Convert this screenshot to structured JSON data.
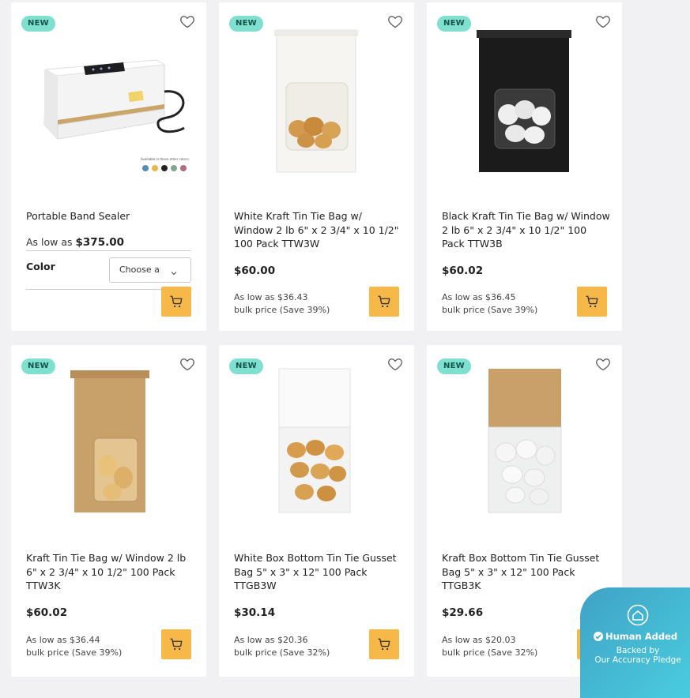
{
  "products": [
    {
      "badge": "NEW",
      "title": "Portable Band Sealer",
      "as_low_prefix": "As low as",
      "as_low_price": "$375.00",
      "color_label": "Color",
      "color_select": "Choose an Option...",
      "swatch_caption": "Available in these other colors:",
      "swatches": [
        "#5a8bb0",
        "#e8b64a",
        "#222222",
        "#7fa58a",
        "#b46a7d"
      ],
      "image": "band-sealer"
    },
    {
      "badge": "NEW",
      "title": "White Kraft Tin Tie Bag w/ Window 2 lb 6\" x 2 3/4\" x 10 1/2\" 100 Pack TTW3W",
      "price": "$60.00",
      "bulk_line1": "As low as $36.43",
      "bulk_line2": "bulk price (Save 39%)",
      "image": "white-tin-tie-bag"
    },
    {
      "badge": "NEW",
      "title": "Black Kraft Tin Tie Bag w/ Window 2 lb 6\" x 2 3/4\" x 10 1/2\" 100 Pack TTW3B",
      "price": "$60.02",
      "bulk_line1": "As low as $36.45",
      "bulk_line2": "bulk price (Save 39%)",
      "image": "black-tin-tie-bag"
    },
    {
      "badge": "NEW",
      "title": "Kraft Tin Tie Bag w/ Window 2 lb 6\" x 2 3/4\" x 10 1/2\" 100 Pack TTW3K",
      "price": "$60.02",
      "bulk_line1": "As low as $36.44",
      "bulk_line2": "bulk price (Save 39%)",
      "image": "kraft-tin-tie-bag"
    },
    {
      "badge": "NEW",
      "title": "White Box Bottom Tin Tie Gusset Bag 5\" x 3\" x 12\" 100 Pack TTGB3W",
      "price": "$30.14",
      "bulk_line1": "As low as $20.36",
      "bulk_line2": "bulk price (Save 32%)",
      "image": "white-gusset-bag"
    },
    {
      "badge": "NEW",
      "title": "Kraft Box Bottom Tin Tie Gusset Bag 5\" x 3\" x 12\" 100 Pack TTGB3K",
      "price": "$29.66",
      "bulk_line1": "As low as $20.03",
      "bulk_line2": "bulk price (Save 32%)",
      "image": "kraft-gusset-bag"
    }
  ],
  "pledge": {
    "title": "Human Added",
    "line1": "Backed by",
    "line2": "Our Accuracy Pledge"
  },
  "colors": {
    "cart_button": "#f5b849",
    "badge_bg": "#7fe0cf",
    "page_bg": "#f1f1f3"
  },
  "icons": {
    "wishlist": "heart-outline-icon",
    "cart": "shopping-cart-icon",
    "select": "chevron-down-icon",
    "pledge": "house-shield-icon",
    "verified": "check-circle-icon"
  }
}
